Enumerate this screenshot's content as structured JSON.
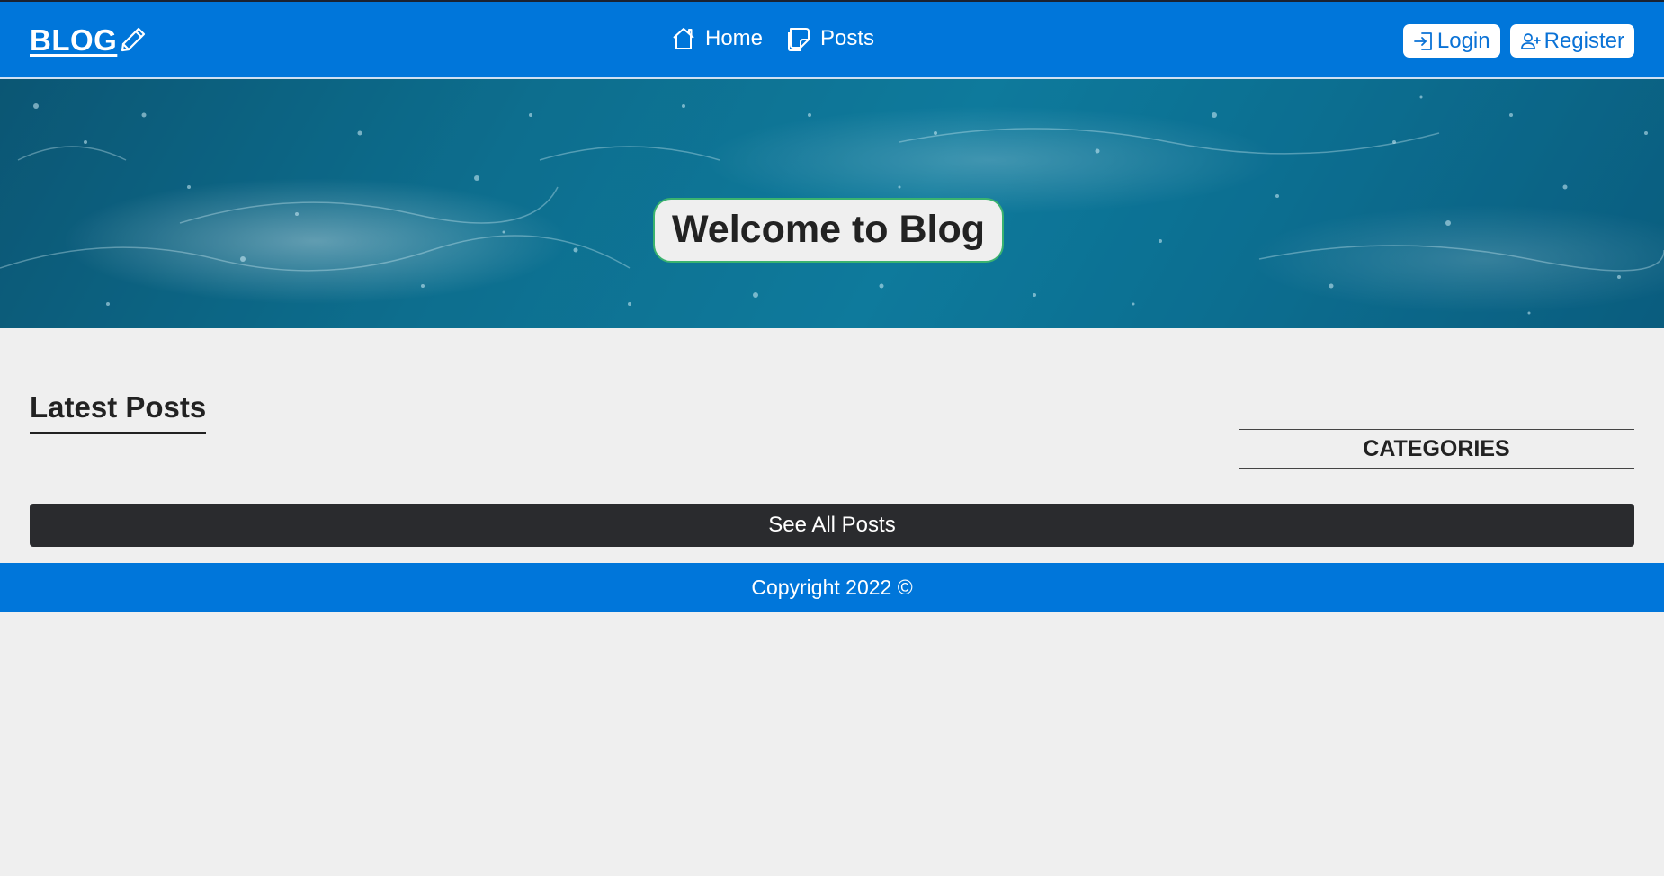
{
  "navbar": {
    "brand": "BLOG",
    "brand_icon": "pencil-icon",
    "links": [
      {
        "label": "Home",
        "icon": "house-icon"
      },
      {
        "label": "Posts",
        "icon": "sticky-note-icon"
      }
    ],
    "login_label": "Login",
    "register_label": "Register",
    "color": "#0076da"
  },
  "hero": {
    "title": "Welcome to Blog"
  },
  "main": {
    "section_title": "Latest Posts",
    "categories_title": "CATEGORIES",
    "see_all_label": "See All Posts"
  },
  "footer": {
    "text": "Copyright 2022 ©"
  }
}
